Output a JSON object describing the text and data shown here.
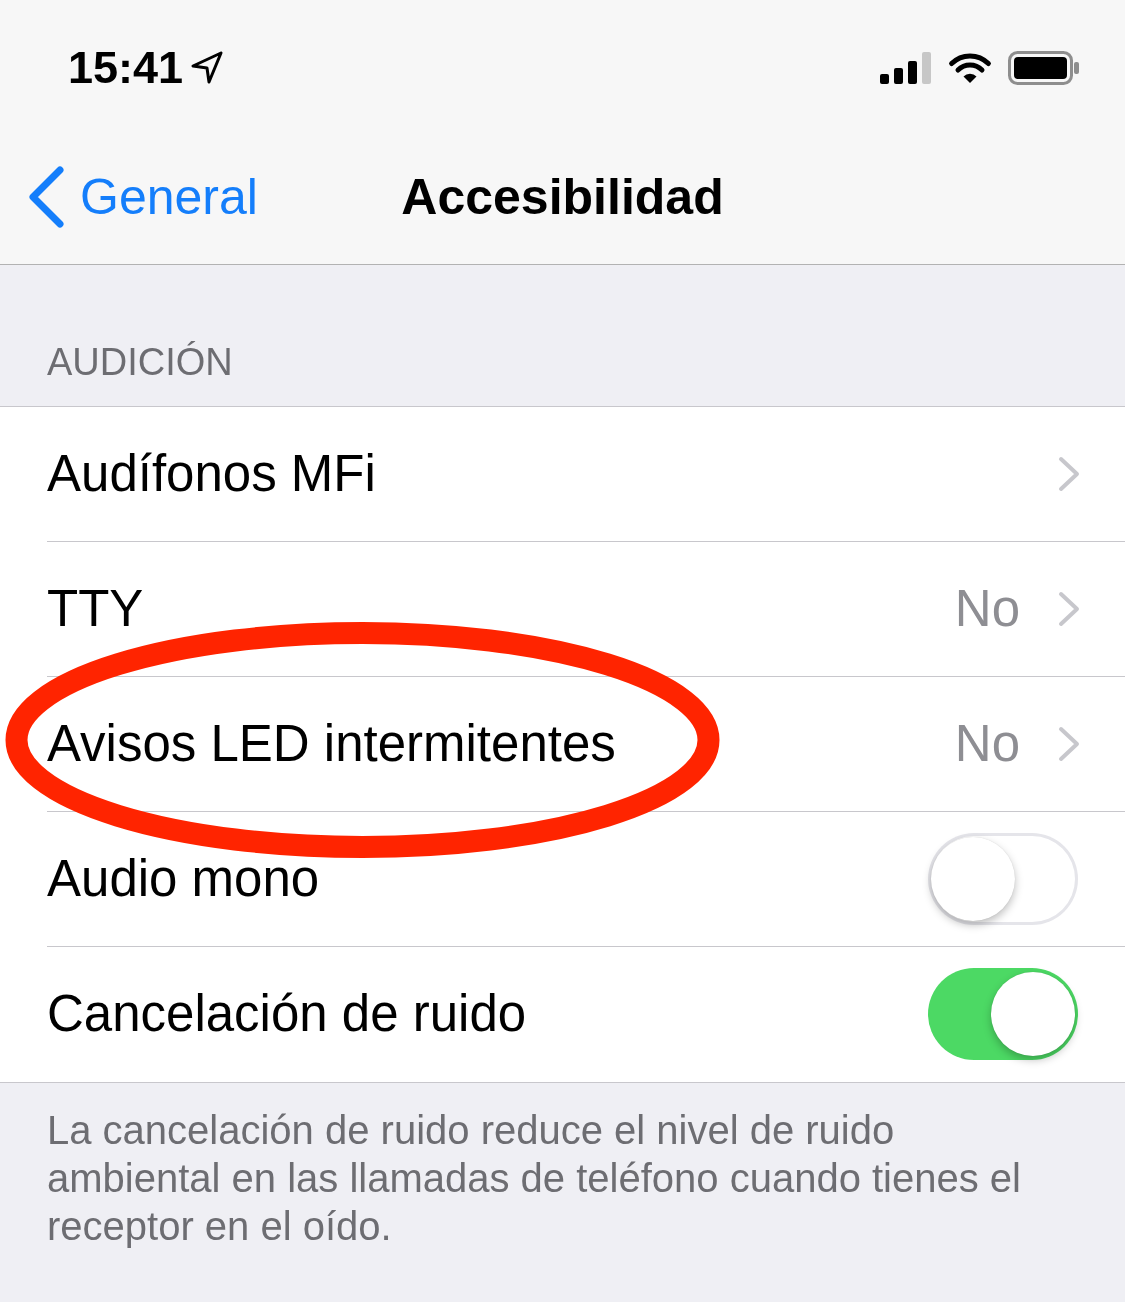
{
  "status_bar": {
    "time": "15:41"
  },
  "nav_bar": {
    "back_label": "General",
    "title": "Accesibilidad"
  },
  "section": {
    "header": "AUDICIÓN",
    "rows": [
      {
        "kind": "link",
        "label": "Audífonos MFi",
        "circled": false
      },
      {
        "kind": "link",
        "label": "TTY",
        "value": "No",
        "circled": false
      },
      {
        "kind": "link",
        "label": "Avisos LED intermitentes",
        "value": "No",
        "circled": true
      },
      {
        "kind": "toggle",
        "label": "Audio mono",
        "on": false,
        "circled": false
      },
      {
        "kind": "toggle",
        "label": "Cancelación de ruido",
        "on": true,
        "circled": false
      }
    ],
    "footer": "La cancelación de ruido reduce el nivel de ruido ambiental en las llamadas de teléfono cuando tienes el receptor en el oído."
  }
}
